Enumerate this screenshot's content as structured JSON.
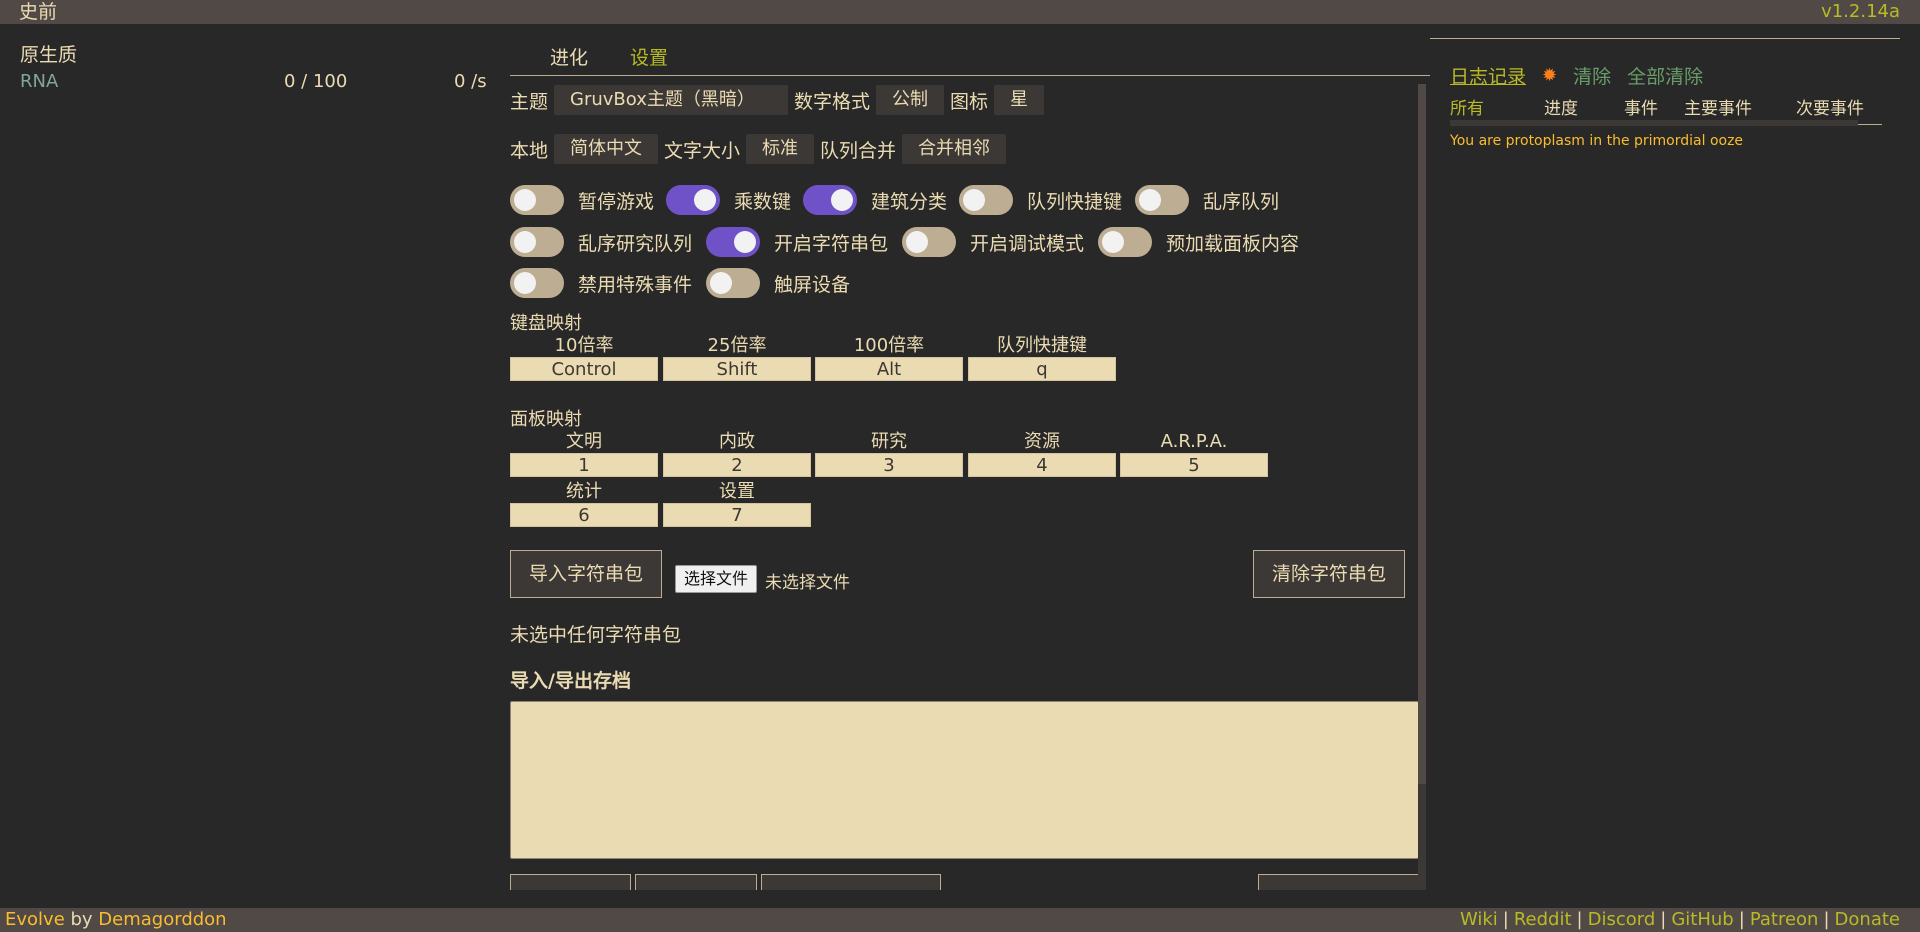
{
  "topbar": {
    "era": "史前",
    "version": "v1.2.14a"
  },
  "resources": {
    "category": "原生质",
    "items": [
      {
        "name": "RNA",
        "amount": "0 / 100",
        "rate": "0 /s"
      }
    ]
  },
  "tabs": [
    {
      "label": "进化"
    },
    {
      "label": "设置"
    }
  ],
  "settings": {
    "theme_label": "主题",
    "theme_value": "GruvBox主题（黑暗）",
    "numfmt_label": "数字格式",
    "numfmt_value": "公制",
    "icon_label": "图标",
    "icon_value": "星",
    "locale_label": "本地",
    "locale_value": "简体中文",
    "fontsize_label": "文字大小",
    "fontsize_value": "标准",
    "queue_merge_label": "队列合并",
    "queue_merge_value": "合并相邻",
    "toggles": [
      {
        "label": "暂停游戏",
        "on": false
      },
      {
        "label": "乘数键",
        "on": true
      },
      {
        "label": "建筑分类",
        "on": true
      },
      {
        "label": "队列快捷键",
        "on": false
      },
      {
        "label": "乱序队列",
        "on": false
      },
      {
        "label": "乱序研究队列",
        "on": false
      },
      {
        "label": "开启字符串包",
        "on": true
      },
      {
        "label": "开启调试模式",
        "on": false
      },
      {
        "label": "预加载面板内容",
        "on": false
      },
      {
        "label": "禁用特殊事件",
        "on": false
      },
      {
        "label": "触屏设备",
        "on": false
      }
    ],
    "keymap_title": "键盘映射",
    "keymap": [
      {
        "label": "10倍率",
        "key": "Control"
      },
      {
        "label": "25倍率",
        "key": "Shift"
      },
      {
        "label": "100倍率",
        "key": "Alt"
      },
      {
        "label": "队列快捷键",
        "key": "q"
      }
    ],
    "tabmap_title": "面板映射",
    "tabmap": [
      {
        "label": "文明",
        "key": "1"
      },
      {
        "label": "内政",
        "key": "2"
      },
      {
        "label": "研究",
        "key": "3"
      },
      {
        "label": "资源",
        "key": "4"
      },
      {
        "label": "A.R.P.A.",
        "key": "5"
      },
      {
        "label": "统计",
        "key": "6"
      },
      {
        "label": "设置",
        "key": "7"
      }
    ],
    "import_strings_label": "导入字符串包",
    "choose_file_label": "选择文件",
    "no_file_label": "未选择文件",
    "clear_strings_label": "清除字符串包",
    "no_string_pack": "未选中任何字符串包",
    "import_export_title": "导入/导出存档",
    "save_textarea_value": ""
  },
  "log": {
    "title": "日志记录",
    "gear_icon": "gear-icon",
    "clear_label": "清除",
    "clear_all_label": "全部清除",
    "tabs": [
      "所有",
      "进度",
      "事件",
      "主要事件",
      "次要事件"
    ],
    "messages": [
      "You are protoplasm in the primordial ooze"
    ]
  },
  "footer": {
    "brand": "Evolve",
    "by": " by ",
    "author": "Demagorddon",
    "links": [
      "Wiki",
      "Reddit",
      "Discord",
      "GitHub",
      "Patreon",
      "Donate"
    ]
  },
  "colors": {
    "background": "#282828",
    "bar": "#504945",
    "accent_green": "#b8bb26",
    "accent_yellow": "#fabd2f",
    "toggle_on": "#6f52c7",
    "input_bg": "#ebdbb2"
  }
}
